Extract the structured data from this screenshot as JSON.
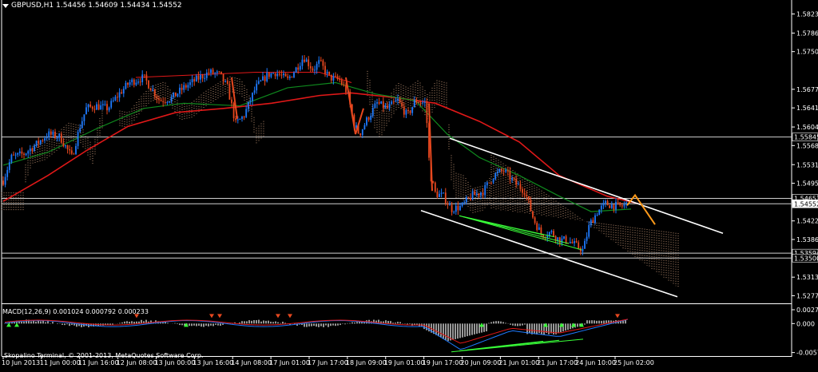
{
  "window": {
    "symbol": "GBPUSD,H1",
    "ohlc": "1.54456 1.54609 1.54434 1.54552",
    "copyright": "Skopalino Terminal, © 2001-2013, MetaQuotes Software Corp."
  },
  "colors": {
    "background": "#000000",
    "bull_candle": "#1e7bff",
    "bear_candle": "#e8481f",
    "ma_slow": "#e01818",
    "ma_fast": "#0f8a1e",
    "cloud": "#e8b28c",
    "channel": "#ffffff",
    "divergence": "#39ff39",
    "forecast": "#ff9a1a",
    "axis_text": "#ffffff",
    "last_price_box": "#ffffff"
  },
  "chart_data": [
    {
      "type": "line",
      "name": "price",
      "y_ticks": [
        "1.58230",
        "1.57860",
        "1.57500",
        "1.56770",
        "1.56410",
        "1.56040",
        "1.55680",
        "1.55310",
        "1.54950",
        "1.54220",
        "1.53860",
        "1.53130",
        "1.52770"
      ],
      "ylim": [
        1.5263,
        1.584
      ],
      "x_ticks": [
        "10 Jun 2013",
        "11 Jun 00:00",
        "11 Jun 16:00",
        "12 Jun 08:00",
        "13 Jun 00:00",
        "13 Jun 16:00",
        "14 Jun 08:00",
        "17 Jun 01:00",
        "17 Jun 17:00",
        "18 Jun 09:00",
        "19 Jun 01:00",
        "19 Jun 17:00",
        "20 Jun 09:00",
        "21 Jun 01:00",
        "21 Jun 17:00",
        "24 Jun 10:00",
        "25 Jun 02:00"
      ],
      "price_lines": [
        {
          "label": "1.55845",
          "value": 1.55845
        },
        {
          "label": "1.54657",
          "value": 1.54657
        },
        {
          "label": "1.54552",
          "value": 1.54552
        },
        {
          "label": "1.53594",
          "value": 1.53594
        },
        {
          "label": "1.53500",
          "value": 1.535
        }
      ],
      "last_price": "1.54552"
    },
    {
      "type": "bar",
      "name": "MACD(12,26,9)",
      "header": "MACD(12,26,9) 0.001024 0.000792 0.000233",
      "y_ticks": [
        "0.00274",
        "0.000",
        "-0.00574"
      ],
      "ylim": [
        -0.0058,
        0.0029
      ]
    }
  ]
}
